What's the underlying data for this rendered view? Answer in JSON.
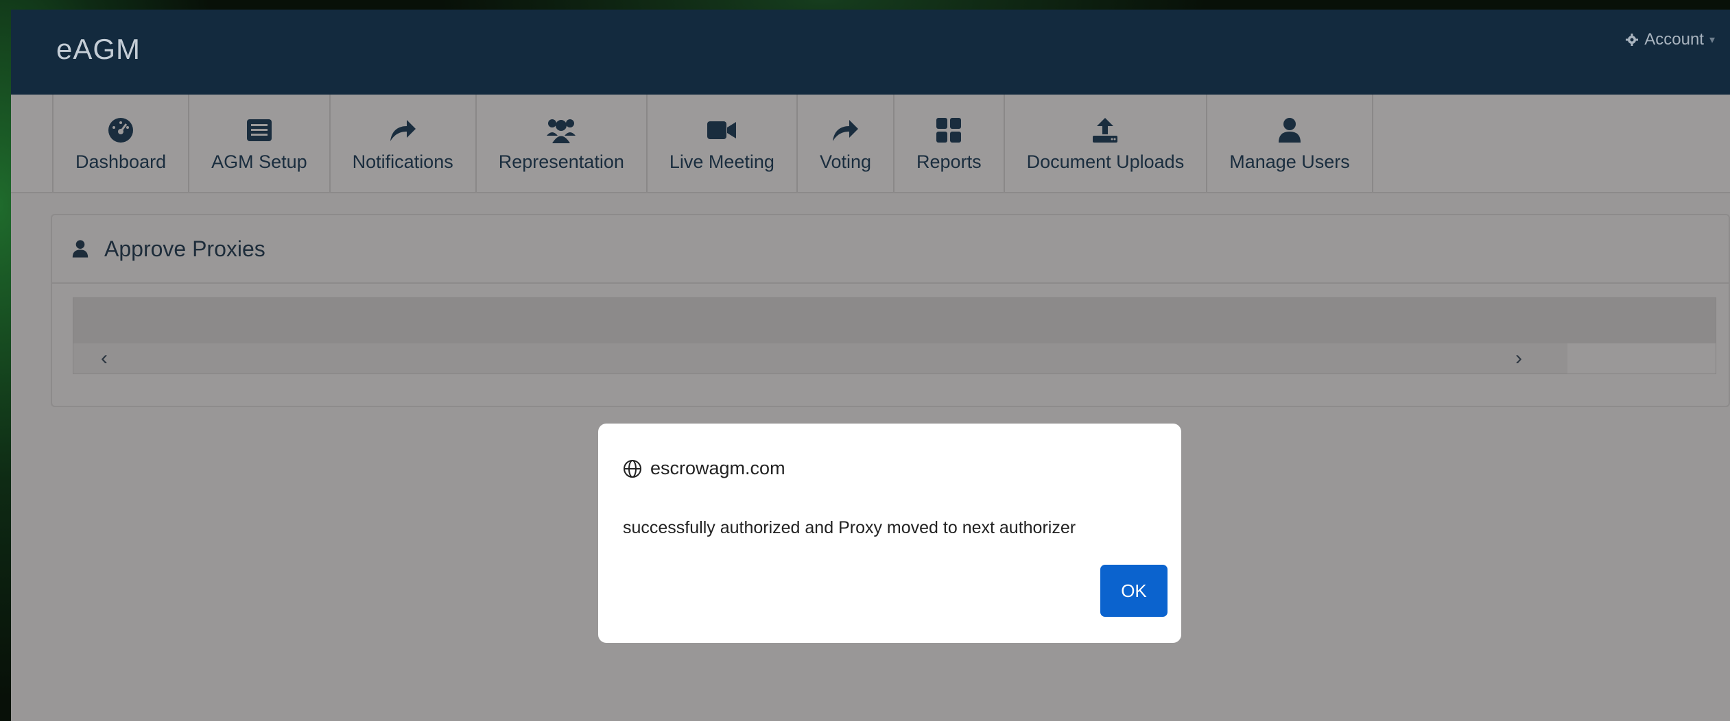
{
  "app": {
    "logo": "eAGM",
    "account_label": "Account"
  },
  "nav": {
    "items": [
      {
        "label": "Dashboard",
        "icon": "dashboard-gauge-icon"
      },
      {
        "label": "AGM Setup",
        "icon": "list-card-icon"
      },
      {
        "label": "Notifications",
        "icon": "share-arrow-icon"
      },
      {
        "label": "Representation",
        "icon": "users-group-icon"
      },
      {
        "label": "Live Meeting",
        "icon": "video-camera-icon"
      },
      {
        "label": "Voting",
        "icon": "share-arrow-icon"
      },
      {
        "label": "Reports",
        "icon": "grid-tiles-icon"
      },
      {
        "label": "Document Uploads",
        "icon": "upload-icon"
      },
      {
        "label": "Manage Users",
        "icon": "user-icon"
      }
    ]
  },
  "panel": {
    "title": "Approve Proxies",
    "icon": "user-icon"
  },
  "table": {
    "scroll_left": "‹",
    "scroll_right": "›"
  },
  "dialog": {
    "origin": "escrowagm.com",
    "message": "successfully authorized and Proxy moved to next authorizer",
    "ok_label": "OK"
  },
  "colors": {
    "topbar": "#132a3e",
    "nav_text": "#1a2d3e",
    "ok_button": "#0b63ce",
    "overlay_gray": "#999797"
  }
}
